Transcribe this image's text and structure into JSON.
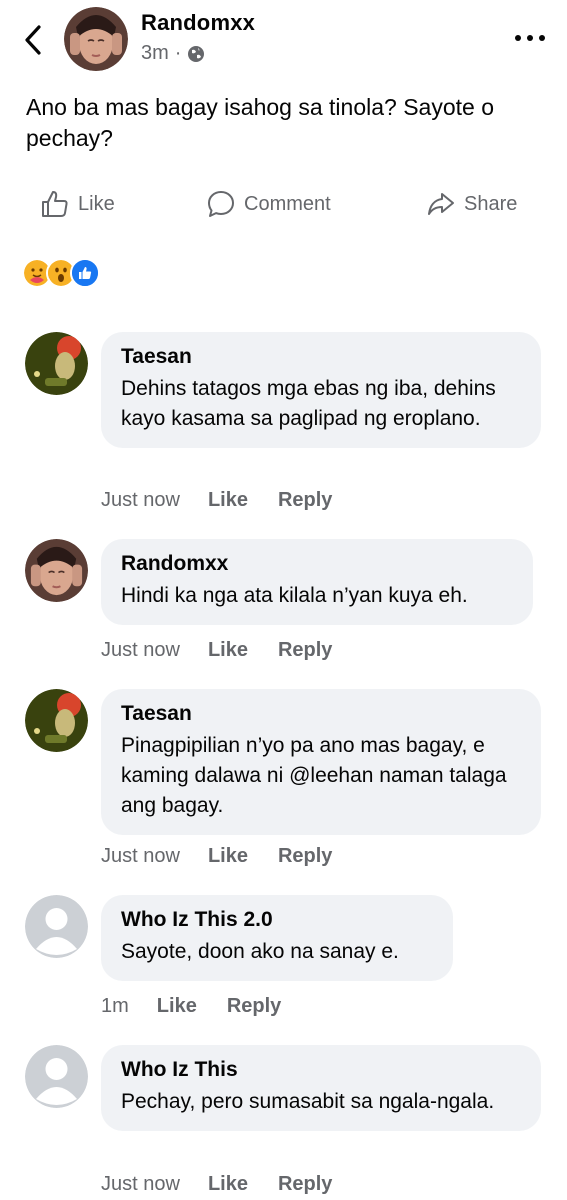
{
  "post": {
    "author": "Randomxx",
    "time": "3m",
    "separator": "·",
    "text": "Ano ba mas bagay isahog sa tinola? Sayote o pechay?"
  },
  "actions": {
    "like": "Like",
    "comment": "Comment",
    "share": "Share"
  },
  "reactions": [
    "care-emoji",
    "wow-emoji",
    "like-emoji"
  ],
  "comments": [
    {
      "name": "Taesan",
      "text": "Dehins tatagos mga ebas ng iba, dehins kayo kasama sa paglipad ng eroplano.",
      "time": "Just now",
      "like": "Like",
      "reply": "Reply"
    },
    {
      "name": "Randomxx",
      "text": "Hindi ka nga ata kilala n’yan kuya eh.",
      "time": "Just now",
      "like": "Like",
      "reply": "Reply"
    },
    {
      "name": "Taesan",
      "text": "Pinagpipilian n’yo pa ano mas bagay, e kaming dalawa ni @leehan naman talaga ang bagay.",
      "time": "Just now",
      "like": "Like",
      "reply": "Reply"
    },
    {
      "name": "Who Iz This 2.0",
      "text": "Sayote, doon ako na sanay e.",
      "time": "1m",
      "like": "Like",
      "reply": "Reply"
    },
    {
      "name": "Who Iz This",
      "text": "Pechay, pero sumasabit sa ngala-ngala.",
      "time": "Just now",
      "like": "Like",
      "reply": "Reply"
    }
  ],
  "colors": {
    "text": "#050505",
    "secondary": "#65676b",
    "bubble": "#f0f2f5",
    "like_blue": "#1877f2"
  }
}
